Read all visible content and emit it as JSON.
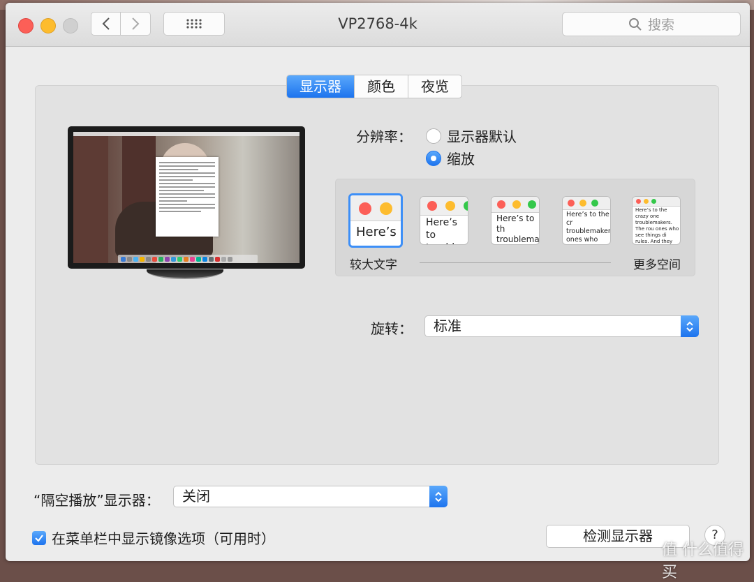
{
  "window": {
    "title": "VP2768-4k"
  },
  "search": {
    "placeholder": "搜索"
  },
  "tabs": [
    {
      "label": "显示器",
      "active": true
    },
    {
      "label": "颜色",
      "active": false
    },
    {
      "label": "夜览",
      "active": false
    }
  ],
  "resolution": {
    "label": "分辨率：",
    "options": [
      {
        "label": "显示器默认",
        "selected": false
      },
      {
        "label": "缩放",
        "selected": true
      }
    ]
  },
  "scaling": {
    "left_label": "较大文字",
    "right_label": "更多空间",
    "thumbs": [
      {
        "text": "Here’s"
      },
      {
        "text": "Here’s to troublem"
      },
      {
        "text": "Here’s to th troublemak ones who c"
      },
      {
        "text": "Here’s to the cr troublemakers. ones who see t rules. And they"
      },
      {
        "text": "Here’s to the crazy one troublemakers. The rou ones who see things di rules. And they have no can quote them, disagre them. About the only th Because they change th"
      }
    ],
    "selected_index": 0
  },
  "rotation": {
    "label": "旋转：",
    "value": "标准"
  },
  "airplay": {
    "label": "“隔空播放”显示器：",
    "value": "关闭"
  },
  "mirror_checkbox": {
    "label": "在菜单栏中显示镜像选项（可用时）",
    "checked": true
  },
  "detect_button": {
    "label": "检测显示器"
  },
  "help_button": {
    "label": "?"
  },
  "watermark": {
    "text": "值 什么值得买"
  },
  "colors": {
    "accent": "#1d74ee",
    "close": "#fc5f57",
    "minimize": "#fdbc2e",
    "zoom": "#d0d0d0"
  }
}
